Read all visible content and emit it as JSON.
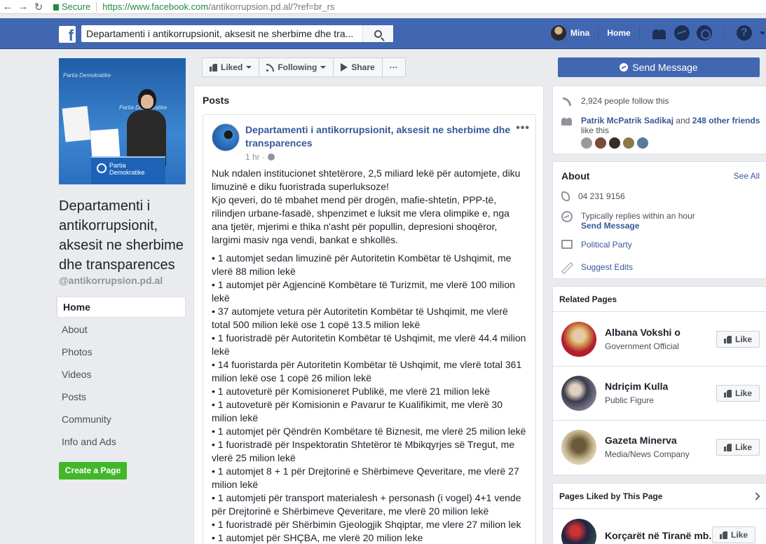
{
  "browser": {
    "secure_label": "Secure",
    "url_host": "https://www.facebook.com",
    "url_path": "/antikorrupsion.pd.al/?ref=br_rs"
  },
  "topbar": {
    "logo": "f",
    "search_value": "Departamenti i antikorrupsionit, aksesit ne sherbime dhe tra...",
    "user_name": "Mina",
    "home_label": "Home",
    "help_glyph": "?"
  },
  "page": {
    "cover_brand": "Partia Demokratike",
    "cover_podium": "Partia\nDemokratike",
    "name": "Departamenti i antikorrupsionit, aksesit ne sherbime dhe transparences",
    "handle": "@antikorrupsion.pd.al",
    "nav": [
      "Home",
      "About",
      "Photos",
      "Videos",
      "Posts",
      "Community",
      "Info and Ads"
    ],
    "create_page": "Create a Page"
  },
  "actions": {
    "liked": "Liked",
    "following": "Following",
    "share": "Share",
    "more": "···",
    "send_message": "Send Message"
  },
  "posts": {
    "title": "Posts",
    "post": {
      "author": "Departamenti i antikorrupsionit, aksesit ne sherbime dhe transparences",
      "time": "1 hr ·",
      "more": "•••",
      "intro": "Nuk ndalen institucionet shtetërore, 2,5 miliard lekë për automjete, diku limuzinë e diku fuoristrada superluksoze!",
      "para": "Kjo qeveri, do të mbahet mend për drogën, mafie-shtetin, PPP-të, rilindjen urbane-fasadë, shpenzimet e luksit me vlera olimpike e, nga ana tjetër, mjerimi e thika n'asht për popullin, depresioni shoqëror, largimi masiv nga vendi, bankat e shkollës.",
      "bullets": [
        "• 1 automjet sedan limuzinë për Autoritetin Kombëtar të Ushqimit, me vlerë 88 milion lekë",
        "• 1 automjet për Agjencinë Kombëtare të Turizmit, me vlerë 100 milion lekë",
        "• 37 automjete vetura për Autoritetin Kombëtar të Ushqimit, me vlerë total 500 milion lekë ose 1 copë 13.5 milion lekë",
        "• 1 fuoristradë për Autoritetin Kombëtar të Ushqimit, me vlerë 44.4 milion lekë",
        "• 14 fuoristarda për Autoritetin Kombëtar të Ushqimit, me vlerë total 361 milion lekë ose 1 copë 26 milion lekë",
        "• 1 autoveturë për Komisioneret Publikë, me vlerë 21 milion lekë",
        "• 1 autoveturë për Komisionin e Pavarur te Kualifikimit, me vlerë 30 milion lekë",
        "• 1 automjet për Qëndrën Kombëtare të Biznesit, me vlerë 25 milion lekë",
        "• 1 fuoristradë për Inspektoratin Shtetëror të Mbikqyrjes së Tregut, me vlerë 25 milion lekë",
        "• 1 automjet 8 + 1 për Drejtorinë e Shërbimeve Qeveritare, me vlerë 27 milion lekë",
        "• 1 automjeti për transport materialesh + personash (i vogel) 4+1 vende për Drejtorinë e Shërbimeve Qeveritare, me vlerë 20 milion lekë",
        "• 1 fuoristradë për Shërbimin Gjeologjik Shqiptar, me vlere 27 milion lek",
        "• 1 automjet për SHÇBA, me vlerë 20 milion leke"
      ]
    }
  },
  "community": {
    "followers": "2,924 people follow this",
    "friend_name": "Patrik McPatrik Sadikaj",
    "and_text": " and ",
    "friends_count": "248 other friends",
    "like_this": "like this"
  },
  "about": {
    "title": "About",
    "see_all": "See All",
    "phone": "04 231 9156",
    "reply_time": "Typically replies within an hour",
    "send_message": "Send Message",
    "category": "Political Party",
    "suggest_edits": "Suggest Edits"
  },
  "related": {
    "title": "Related Pages",
    "items": [
      {
        "name": "Albana Vokshi o",
        "category": "Government Official",
        "like": "Like"
      },
      {
        "name": "Ndriçim Kulla",
        "category": "Public Figure",
        "like": "Like"
      },
      {
        "name": "Gazeta Minerva",
        "category": "Media/News Company",
        "like": "Like"
      }
    ]
  },
  "liked_pages": {
    "title": "Pages Liked by This Page",
    "first_name": "Korçarët në Tiranë mb...",
    "like": "Like"
  },
  "colors": {
    "fb_blue": "#4267b2",
    "link_blue": "#365899",
    "create_green": "#42b72a",
    "secure_green": "#1e8e3e"
  }
}
